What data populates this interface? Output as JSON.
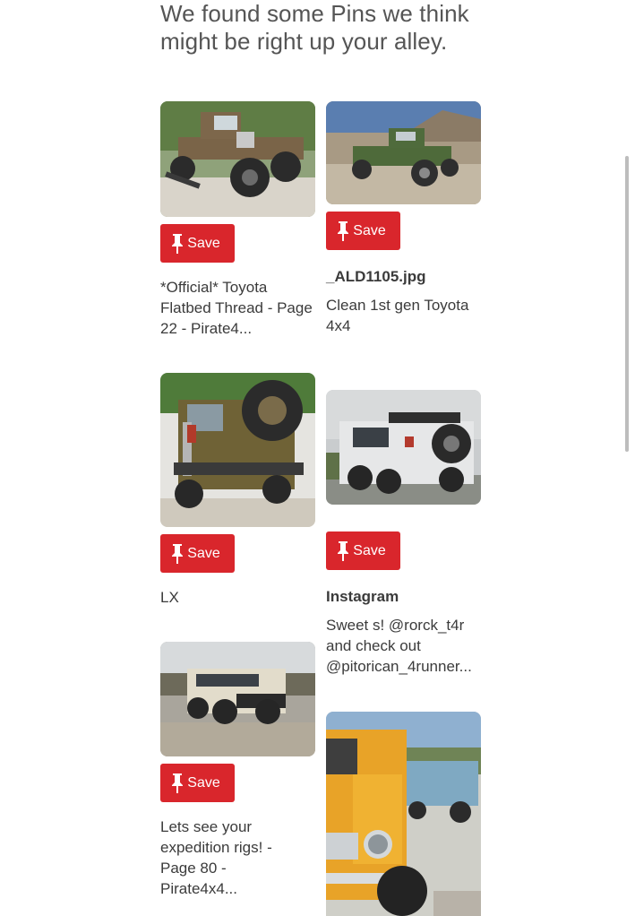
{
  "header": {
    "line1": "We found some Pins we think",
    "line2": "might be right up your alley."
  },
  "save_label": "Save",
  "pins": [
    {
      "title": "",
      "description": "*Official* Toyota Flatbed Thread - Page 22 - Pirate4...",
      "image_icon": "flatbed-truck-photo"
    },
    {
      "title": "_ALD1105.jpg",
      "description": "Clean 1st gen Toyota 4x4",
      "image_icon": "green-pickup-photo"
    },
    {
      "title": "",
      "description": "LX",
      "image_icon": "spare-tire-carrier-photo"
    },
    {
      "title": "Instagram",
      "description": "Sweet s! @rorck_t4r and check out @pitorican_4runner...",
      "image_icon": "white-4runner-photo"
    },
    {
      "title": "",
      "description": "Lets see your expedition rigs! - Page 80 - Pirate4x4...",
      "image_icon": "land-cruiser-photo"
    },
    {
      "title": "",
      "description": "",
      "image_icon": "yellow-fj40-photo"
    }
  ],
  "colors": {
    "save_button": "#d9262c",
    "text": "#3b3b3b",
    "headline": "#555555"
  }
}
